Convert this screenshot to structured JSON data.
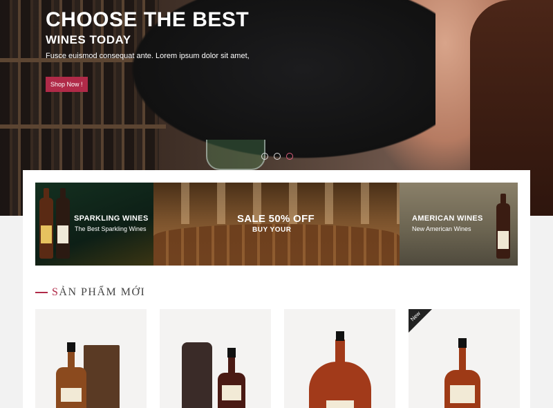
{
  "hero": {
    "title": "CHOOSE THE BEST",
    "subtitle": "WINES TODAY",
    "text": "Fusce euismod consequat ante. Lorem ipsum dolor sit amet,",
    "button_label": "Shop Now !",
    "slides": 3,
    "active_slide": 3,
    "accent_color": "#b02a48"
  },
  "banners": [
    {
      "title": "SPARKLING WINES",
      "subtitle": "The Best Sparkling Wines"
    },
    {
      "title": "SALE 50% OFF",
      "subtitle": "BUY YOUR"
    },
    {
      "title": "AMERICAN WINES",
      "subtitle": "New American Wines"
    }
  ],
  "section": {
    "title_first": "S",
    "title_rest": "ẢN PHẨM MỚI"
  },
  "products": [
    {
      "badge": ""
    },
    {
      "badge": ""
    },
    {
      "badge": ""
    },
    {
      "badge": "New"
    }
  ]
}
